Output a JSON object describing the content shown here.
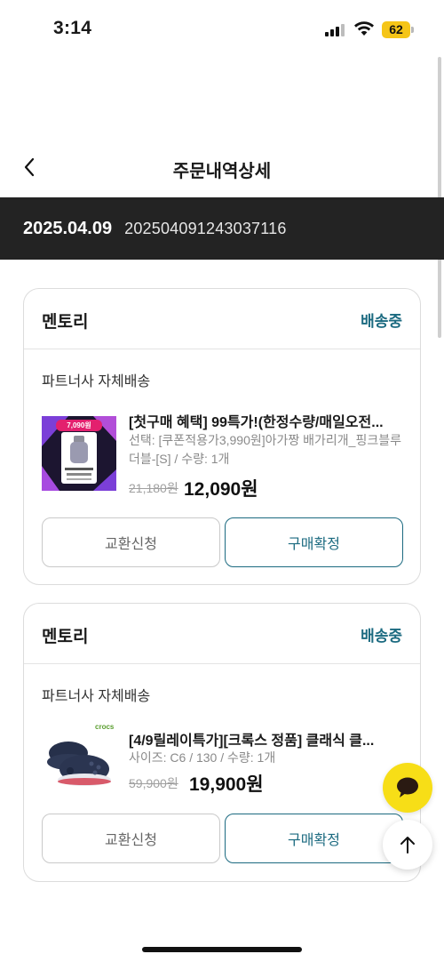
{
  "status_bar": {
    "time": "3:14",
    "battery": "62"
  },
  "header": {
    "title": "주문내역상세"
  },
  "order": {
    "date": "2025.04.09",
    "number": "202504091243037116"
  },
  "orders": [
    {
      "seller": "멘토리",
      "status": "배송중",
      "shipping_type": "파트너사 자체배송",
      "product": {
        "title": "[첫구매 혜택] 99특가!(한정수량/매일오전...",
        "option": "선택: [쿠폰적용가3,990원]아가짱 배가리개_핑크블루 더블-[S] / 수량: 1개",
        "original_price": "21,180원",
        "price": "12,090원",
        "thumb_badge": "7,090원"
      },
      "buttons": {
        "exchange": "교환신청",
        "confirm": "구매확정"
      }
    },
    {
      "seller": "멘토리",
      "status": "배송중",
      "shipping_type": "파트너사 자체배송",
      "product": {
        "title": "[4/9릴레이특가][크록스 정품] 클래식 클...",
        "option": "사이즈: C6 / 130 / 수량: 1개",
        "original_price": "59,900원",
        "price": "19,900원",
        "thumb_brand": "crocs"
      },
      "buttons": {
        "exchange": "교환신청",
        "confirm": "구매확정"
      }
    }
  ],
  "colors": {
    "accent": "#1b6a80",
    "order_bar": "#232323",
    "chat": "#f7de17"
  },
  "icons": [
    "back-icon",
    "chat-icon",
    "arrow-up-icon",
    "signal-icon",
    "wifi-icon",
    "battery-icon"
  ]
}
